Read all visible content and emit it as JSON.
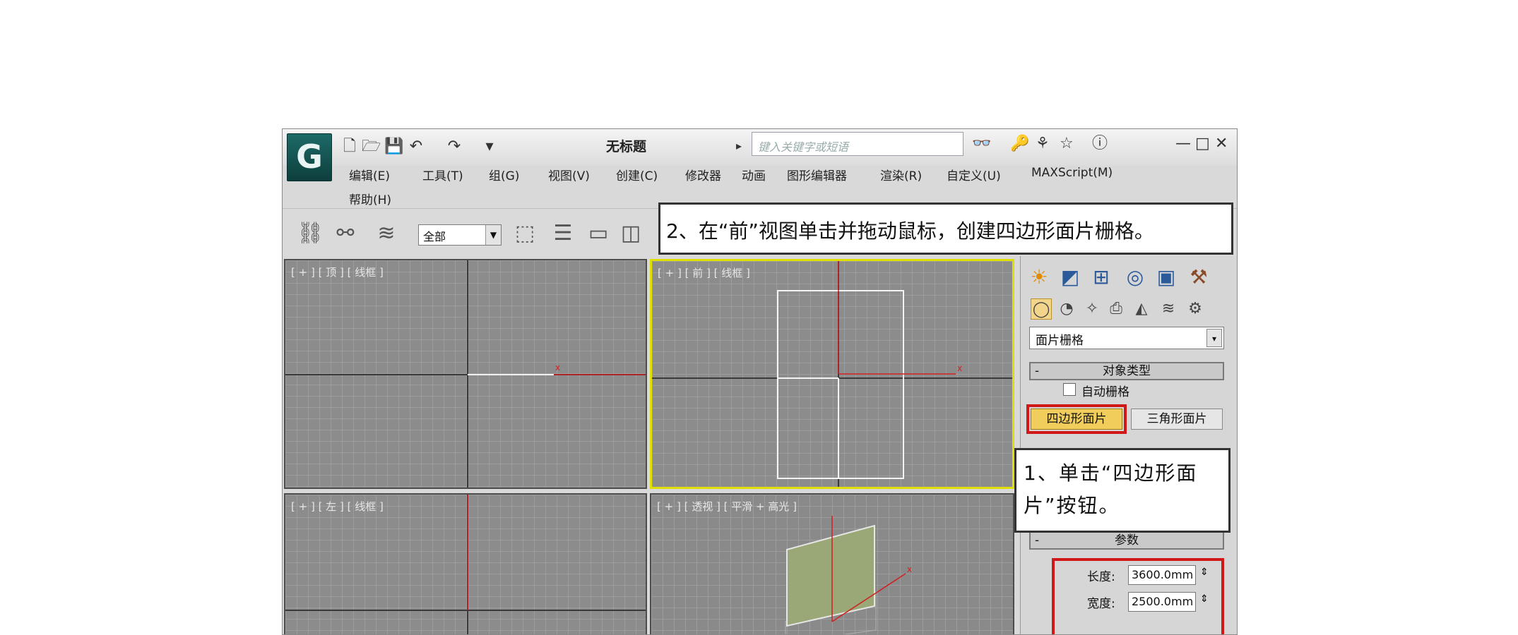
{
  "app": {
    "title": "无标题",
    "logo": "G",
    "search_placeholder": "键入关键字或短语",
    "quick_access": [
      "new-icon",
      "open-icon",
      "save-icon",
      "undo-icon",
      "redo-icon",
      "dropdown-icon"
    ],
    "window_controls": {
      "minimize": "—",
      "maximize": "□",
      "close": "✕"
    }
  },
  "menu": [
    "编辑(E)",
    "工具(T)",
    "组(G)",
    "视图(V)",
    "创建(C)",
    "修改器",
    "动画",
    "图形编辑器",
    "渲染(R)",
    "自定义(U)",
    "MAXScript(M)",
    "帮助(H)"
  ],
  "toolbar": {
    "filter_value": "全部"
  },
  "viewports": [
    {
      "label": "[ + ] [ 顶 ] [ 线框 ]"
    },
    {
      "label": "[ + ] [ 前 ] [ 线框 ]"
    },
    {
      "label": "[ + ] [ 左 ] [ 线框 ]"
    },
    {
      "label": "[ + ] [ 透视 ] [ 平滑 + 高光 ]"
    }
  ],
  "panel": {
    "dropdown_value": "面片栅格",
    "rollout_object_type": "对象类型",
    "autogrid_label": "自动栅格",
    "quad_patch_button": "四边形面片",
    "tri_patch_button": "三角形面片",
    "rollout_params": "参数",
    "length_label": "长度:",
    "length_value": "3600.0mm",
    "width_label": "宽度:",
    "width_value": "2500.0mm",
    "collapse_symbol": "-"
  },
  "callouts": {
    "step2": "2、在“前”视图单击并拖动鼠标，创建四边形面片栅格。",
    "step1": "1、单击“四边形面片”按钮。"
  },
  "colors": {
    "highlight_border": "#e0e000",
    "red_box": "#d01818",
    "axis_red": "#d02020"
  }
}
